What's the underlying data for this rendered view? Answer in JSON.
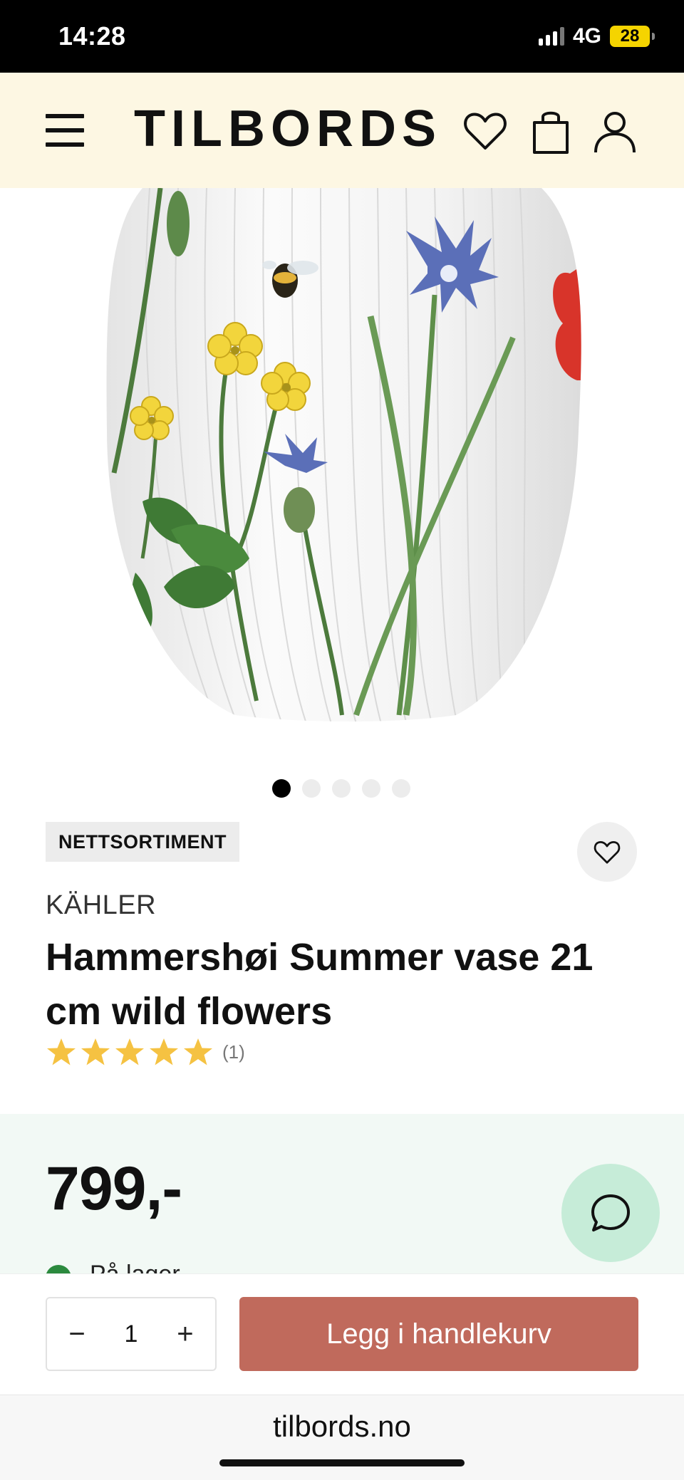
{
  "status_bar": {
    "time": "14:28",
    "network": "4G",
    "battery": "28"
  },
  "header": {
    "logo": "TILBORDS",
    "menu_icon": "hamburger-menu-icon",
    "wishlist_icon": "heart-icon",
    "cart_icon": "shopping-bag-icon",
    "account_icon": "user-icon",
    "background_color": "#fdf7e3"
  },
  "product": {
    "image_subject": "white ribbed vase with wild flowers",
    "carousel": {
      "total": 5,
      "active_index": 0
    },
    "badge": "NETTSORTIMENT",
    "brand": "KÄHLER",
    "title": "Hammershøi Summer vase 21 cm wild flowers",
    "rating": {
      "stars": 5,
      "max": 5,
      "review_count_label": "(1)"
    },
    "price": "799,-",
    "stock_status": "På lager",
    "star_color": "#f5c242"
  },
  "purchase": {
    "quantity": "1",
    "decrement_label": "−",
    "increment_label": "+",
    "add_to_cart_label": "Legg i handlekurv",
    "button_color": "#c06a5c"
  },
  "chat": {
    "icon": "chat-bubble-icon",
    "color": "#c6ecd8"
  },
  "browser": {
    "url": "tilbords.no"
  }
}
